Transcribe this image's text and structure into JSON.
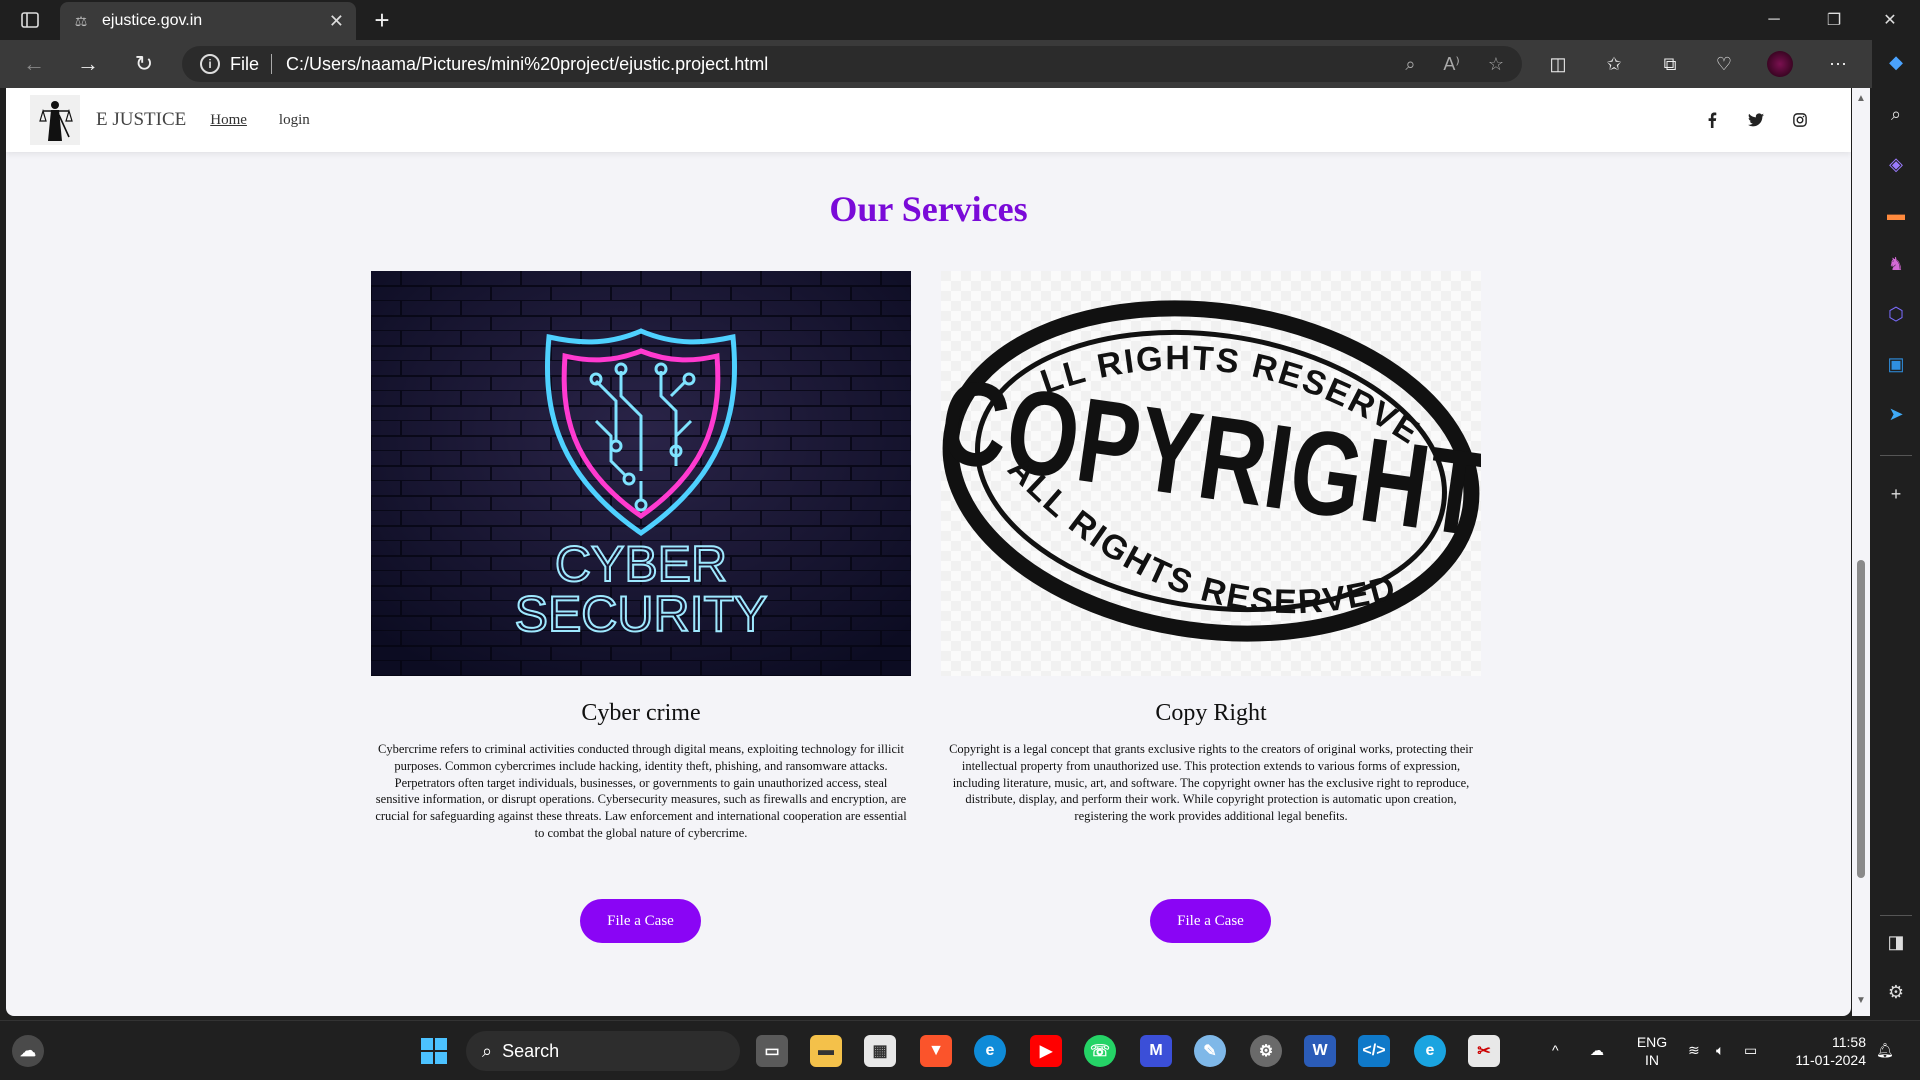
{
  "browser": {
    "tab_title": "ejustice.gov.in",
    "url": "C:/Users/naama/Pictures/mini%20project/ejustic.project.html",
    "file_label": "File",
    "read_aloud_label": "A⁾"
  },
  "site": {
    "brand": "E JUSTICE",
    "nav": [
      {
        "label": "Home",
        "active": true
      },
      {
        "label": "login",
        "active": false
      }
    ],
    "social": [
      "facebook-icon",
      "twitter-icon",
      "instagram-icon"
    ],
    "accent_color": "#8a05f5",
    "title_color": "#7a0ad8"
  },
  "services": {
    "title": "Our Services",
    "cards": [
      {
        "image_text": [
          "CYBER",
          "SECURITY"
        ],
        "heading": "Cyber crime",
        "description": "Cybercrime refers to criminal activities conducted through digital means, exploiting technology for illicit purposes. Common cybercrimes include hacking, identity theft, phishing, and ransomware attacks. Perpetrators often target individuals, businesses, or governments to gain unauthorized access, steal sensitive information, or disrupt operations. Cybersecurity measures, such as firewalls and encryption, are crucial for safeguarding against these threats. Law enforcement and international cooperation are essential to combat the global nature of cybercrime.",
        "button": "File a Case"
      },
      {
        "image_text": [
          "ALL RIGHTS RESERVED",
          "COPYRIGHT",
          "ALL RIGHTS RESERVED"
        ],
        "heading": "Copy Right",
        "description": "Copyright is a legal concept that grants exclusive rights to the creators of original works, protecting their intellectual property from unauthorized use. This protection extends to various forms of expression, including literature, music, art, and software. The copyright owner has the exclusive right to reproduce, distribute, display, and perform their work. While copyright protection is automatic upon creation, registering the work provides additional legal benefits.",
        "button": "File a Case"
      }
    ]
  },
  "taskbar": {
    "search_label": "Search",
    "language": "ENG",
    "region": "IN",
    "time": "11:58",
    "date": "11-01-2024"
  }
}
